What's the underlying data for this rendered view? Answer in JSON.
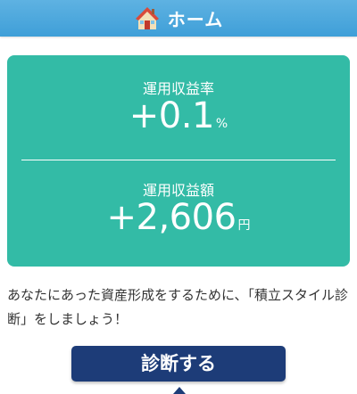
{
  "header": {
    "icon": "house-icon",
    "title": "ホーム"
  },
  "card": {
    "yield_rate": {
      "label": "運用収益率",
      "value": "+0.1",
      "unit": "%"
    },
    "yield_amount": {
      "label": "運用収益額",
      "value": "+2,606",
      "unit": "円"
    }
  },
  "description": "あなたにあった資産形成をするために、「積立スタイル診断」をしましょう！",
  "diagnose_button": {
    "label": "診断する"
  },
  "colors": {
    "header": "#4aa8dd",
    "card": "#33bba6",
    "button": "#1d3c78"
  }
}
